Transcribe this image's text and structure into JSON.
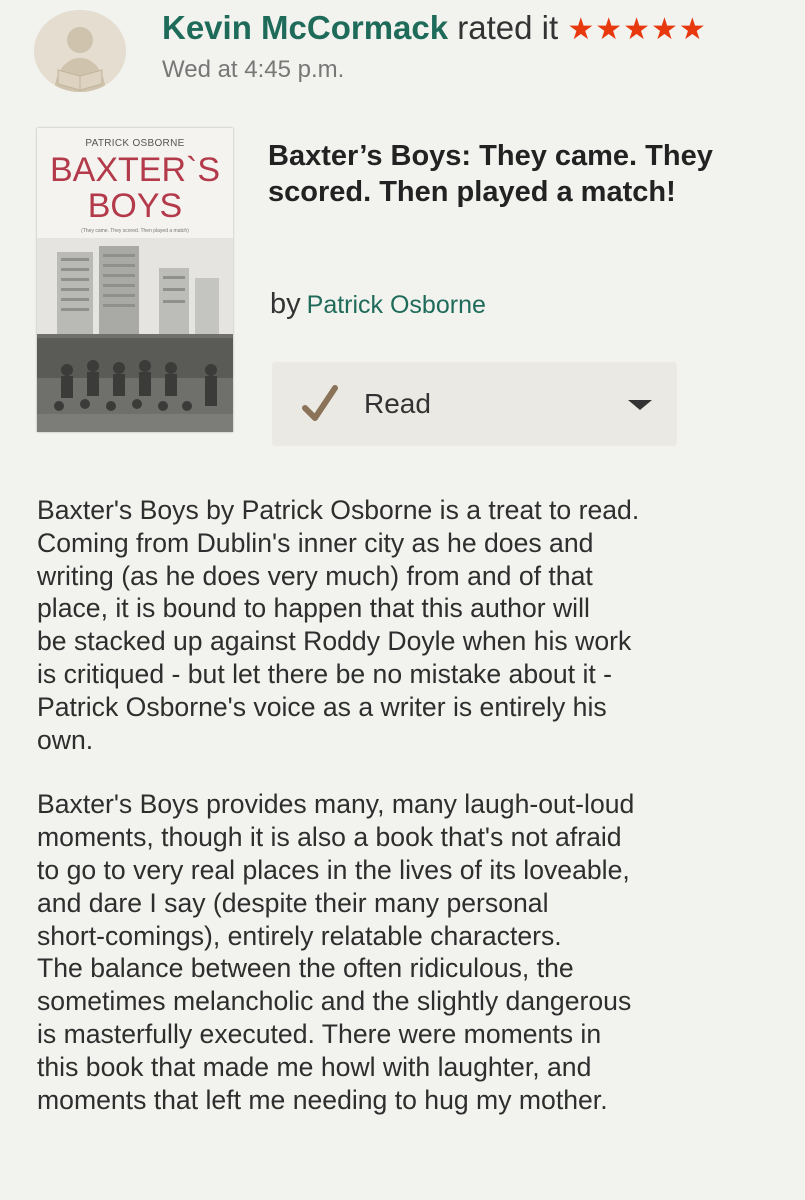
{
  "activity": {
    "user_name": "Kevin McCormack",
    "action": "rated it",
    "stars": "★★★★★",
    "rating": 5,
    "timestamp": "Wed at 4:45 p.m."
  },
  "book": {
    "title": "Baxter’s Boys: They came. They scored. Then played a match!",
    "by_label": "by",
    "author": "Patrick Osborne",
    "cover": {
      "author": "PATRICK OSBORNE",
      "title_line1": "BAXTER`S",
      "title_line2": "BOYS",
      "tagline": "(They came. They scored. Then played a match)"
    }
  },
  "shelf_button": {
    "label": "Read"
  },
  "review": {
    "paragraphs": [
      [
        "Baxter's Boys by Patrick Osborne is a treat to read.",
        "Coming from Dublin's inner city as he does and",
        "writing (as he does very much) from and of that",
        "place, it is bound to happen that this author will",
        "be stacked up against Roddy Doyle when his work",
        "is critiqued - but let there be no mistake about it -",
        "Patrick Osborne's voice as a writer is entirely his",
        "own."
      ],
      [
        "Baxter's Boys provides many, many laugh-out-loud",
        "moments, though it is also a book that's not afraid",
        "to go to very real places in the lives of its loveable,",
        "and dare I say (despite their many personal",
        "short-comings), entirely relatable characters.",
        "The balance between the often ridiculous, the",
        "sometimes melancholic and the slightly dangerous",
        "is masterfully executed. There were moments in",
        "this book that made me howl with laughter, and",
        "moments that left me needing to hug my mother."
      ]
    ]
  },
  "colors": {
    "link_green": "#1f6b5a",
    "star_red": "#e8390e",
    "button_bg": "#ebe9e3",
    "check_brown": "#8a7358"
  }
}
